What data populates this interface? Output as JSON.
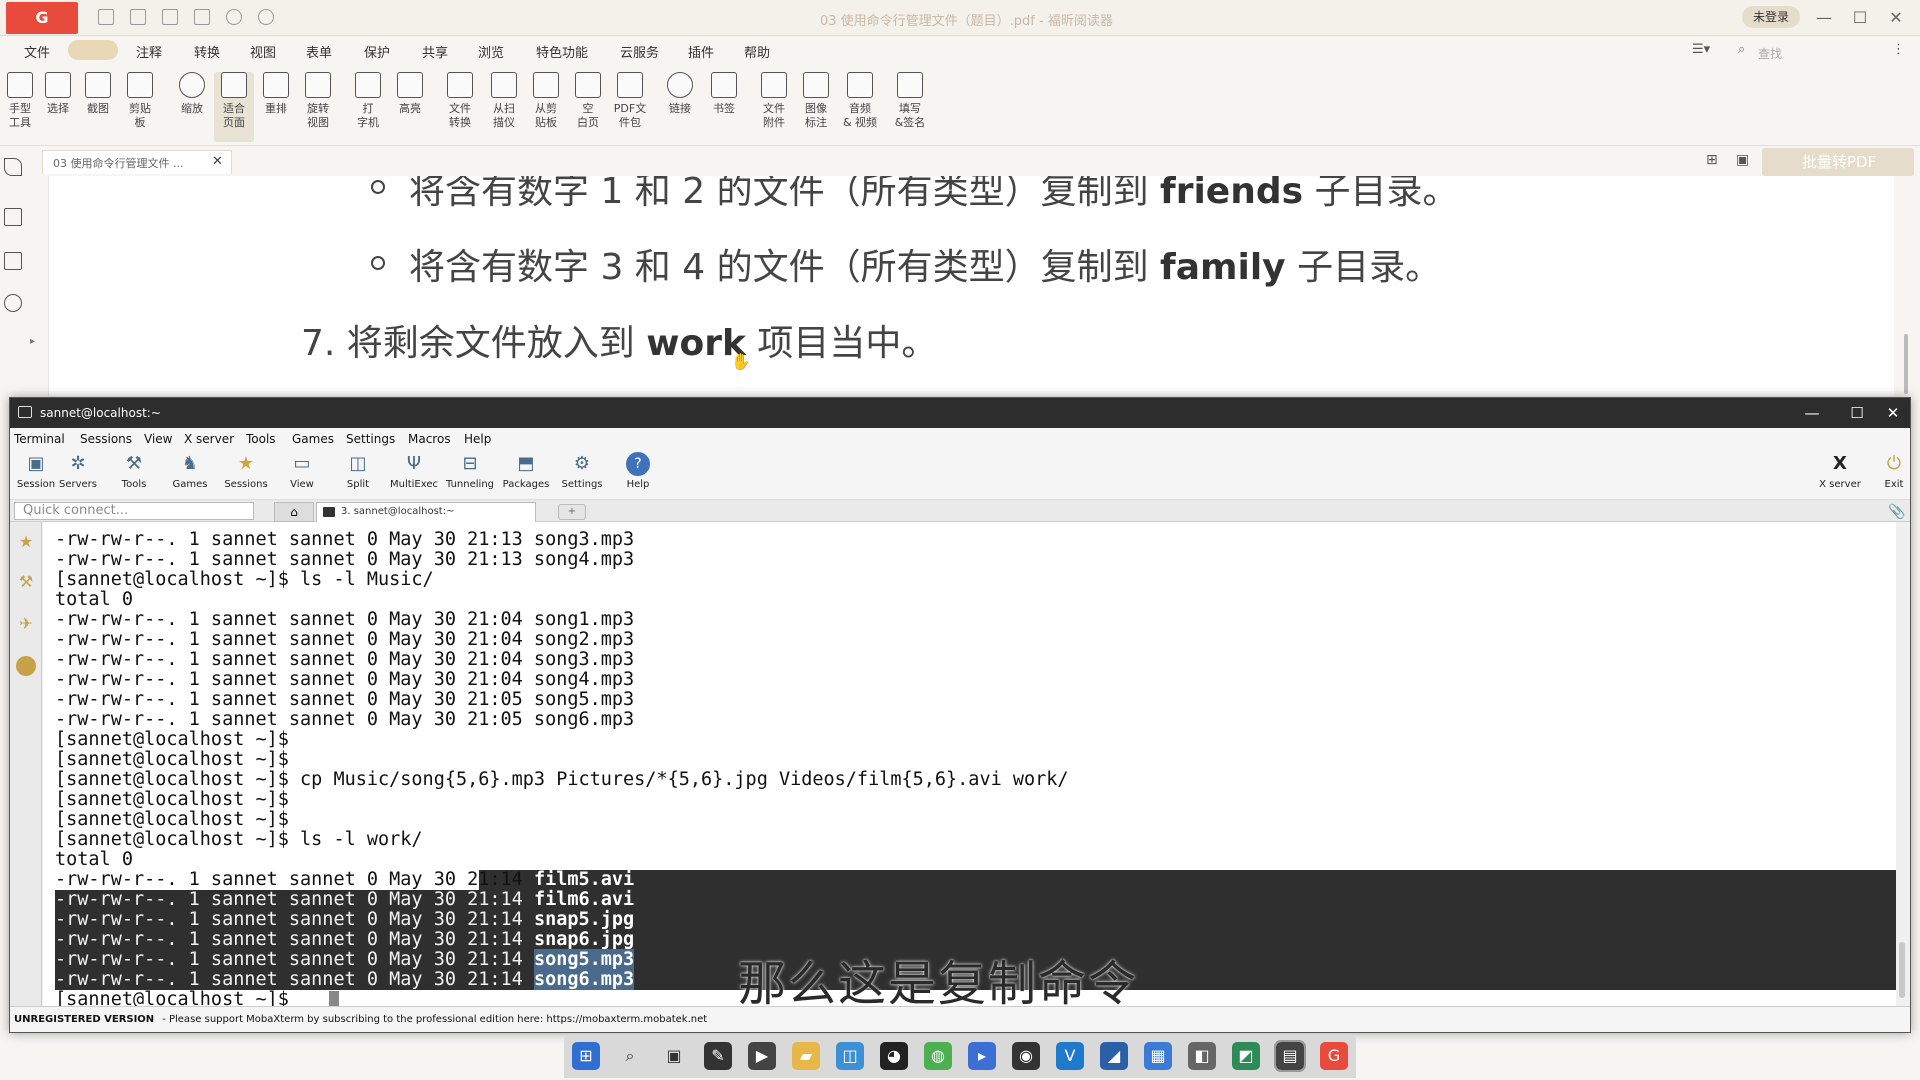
{
  "pdf_reader": {
    "title": "03 使用命令行管理文件（题目）.pdf - 福昕阅读器",
    "login_label": "未登录",
    "menu": [
      "文件",
      "注释",
      "转换",
      "视图",
      "表单",
      "保护",
      "共享",
      "浏览",
      "特色功能",
      "云服务",
      "插件",
      "帮助"
    ],
    "search_placeholder": "查找",
    "ribbon": [
      {
        "label": "手型\n工具",
        "icon": "hand-icon"
      },
      {
        "label": "选择",
        "icon": "text-select-icon"
      },
      {
        "label": "截图",
        "icon": "screenshot-icon"
      },
      {
        "label": "剪贴\n板",
        "icon": "clipboard-icon"
      },
      {
        "label": "缩放",
        "icon": "zoom-icon"
      },
      {
        "label": "适合\n页面",
        "icon": "fit-page-icon"
      },
      {
        "label": "重排",
        "icon": "reflow-icon"
      },
      {
        "label": "旋转\n视图",
        "icon": "rotate-icon"
      },
      {
        "label": "打\n字机",
        "icon": "typewriter-icon"
      },
      {
        "label": "高亮",
        "icon": "highlight-icon"
      },
      {
        "label": "文件\n转换",
        "icon": "file-convert-icon"
      },
      {
        "label": "从扫\n描仪",
        "icon": "scanner-icon"
      },
      {
        "label": "从剪\n贴板",
        "icon": "from-clipboard-icon"
      },
      {
        "label": "空\n白页",
        "icon": "blank-page-icon"
      },
      {
        "label": "PDF文\n件包",
        "icon": "pdf-package-icon"
      },
      {
        "label": "链接",
        "icon": "link-icon"
      },
      {
        "label": "书签",
        "icon": "bookmark-icon"
      },
      {
        "label": "文件\n附件",
        "icon": "attachment-icon"
      },
      {
        "label": "图像\n标注",
        "icon": "image-annotation-icon"
      },
      {
        "label": "音频\n& 视频",
        "icon": "audio-video-icon"
      },
      {
        "label": "填写\n&签名",
        "icon": "fill-sign-icon"
      }
    ],
    "doc_tab": "03 使用命令行管理文件 ...",
    "batch_button": "批量转PDF",
    "page_lines": {
      "line1_pre": "将含有数字 1 和 2 的文件（所有类型）复制到 ",
      "line1_bold": "friends",
      "line1_post": " 子目录。",
      "line2_pre": "将含有数字 3 和 4 的文件（所有类型）复制到 ",
      "line2_bold": "family",
      "line2_post": " 子目录。",
      "line3_pre": "7. 将剩余文件放入到 ",
      "line3_bold": "work",
      "line3_post": " 项目当中。"
    }
  },
  "mobaxterm": {
    "title": "sannet@localhost:~",
    "menu": [
      "Terminal",
      "Sessions",
      "View",
      "X server",
      "Tools",
      "Games",
      "Settings",
      "Macros",
      "Help"
    ],
    "toolbar": [
      {
        "label": "Session",
        "icon": "session-icon"
      },
      {
        "label": "Servers",
        "icon": "servers-icon"
      },
      {
        "label": "Tools",
        "icon": "tools-icon"
      },
      {
        "label": "Games",
        "icon": "games-icon"
      },
      {
        "label": "Sessions",
        "icon": "star-icon"
      },
      {
        "label": "View",
        "icon": "view-icon"
      },
      {
        "label": "Split",
        "icon": "split-icon"
      },
      {
        "label": "MultiExec",
        "icon": "multiexec-icon"
      },
      {
        "label": "Tunneling",
        "icon": "tunneling-icon"
      },
      {
        "label": "Packages",
        "icon": "packages-icon"
      },
      {
        "label": "Settings",
        "icon": "settings-icon"
      },
      {
        "label": "Help",
        "icon": "help-icon"
      }
    ],
    "toolbar_right": [
      {
        "label": "X server",
        "icon": "x-server-icon"
      },
      {
        "label": "Exit",
        "icon": "exit-icon"
      }
    ],
    "quick_connect_placeholder": "Quick connect...",
    "session_tab": "3. sannet@localhost:~",
    "terminal_lines": [
      "-rw-rw-r--. 1 sannet sannet 0 May 30 21:13 song3.mp3",
      "-rw-rw-r--. 1 sannet sannet 0 May 30 21:13 song4.mp3",
      "[sannet@localhost ~]$ ls -l Music/",
      "total 0",
      "-rw-rw-r--. 1 sannet sannet 0 May 30 21:04 song1.mp3",
      "-rw-rw-r--. 1 sannet sannet 0 May 30 21:04 song2.mp3",
      "-rw-rw-r--. 1 sannet sannet 0 May 30 21:04 song3.mp3",
      "-rw-rw-r--. 1 sannet sannet 0 May 30 21:04 song4.mp3",
      "-rw-rw-r--. 1 sannet sannet 0 May 30 21:05 song5.mp3",
      "-rw-rw-r--. 1 sannet sannet 0 May 30 21:05 song6.mp3",
      "[sannet@localhost ~]$",
      "[sannet@localhost ~]$",
      "[sannet@localhost ~]$ cp Music/song{5,6}.mp3 Pictures/*{5,6}.jpg Videos/film{5,6}.avi work/",
      "[sannet@localhost ~]$",
      "[sannet@localhost ~]$",
      "[sannet@localhost ~]$ ls -l work/",
      "total 0"
    ],
    "work_listing": [
      {
        "meta": "-rw-rw-r--. 1 sannet sannet 0 May 30 21:14 ",
        "name": "film5.avi",
        "row_highlight": false,
        "name_selected": false
      },
      {
        "meta": "-rw-rw-r--. 1 sannet sannet 0 May 30 21:14 ",
        "name": "film6.avi",
        "row_highlight": true,
        "name_selected": false
      },
      {
        "meta": "-rw-rw-r--. 1 sannet sannet 0 May 30 21:14 ",
        "name": "snap5.jpg",
        "row_highlight": true,
        "name_selected": false
      },
      {
        "meta": "-rw-rw-r--. 1 sannet sannet 0 May 30 21:14 ",
        "name": "snap6.jpg",
        "row_highlight": true,
        "name_selected": false
      },
      {
        "meta": "-rw-rw-r--. 1 sannet sannet 0 May 30 21:14 ",
        "name": "song5.mp3",
        "row_highlight": true,
        "name_selected": true
      },
      {
        "meta": "-rw-rw-r--. 1 sannet sannet 0 May 30 21:14 ",
        "name": "song6.mp3",
        "row_highlight": true,
        "name_selected": true
      }
    ],
    "prompt": "[sannet@localhost ~]$ ",
    "subtitle": "那么这是复制命令",
    "status_bold": "UNREGISTERED VERSION",
    "status_text": "-  Please support MobaXterm by subscribing to the professional edition here:  https://mobaxterm.mobatek.net"
  },
  "taskbar_icons": [
    "windows-start-icon",
    "search-icon",
    "task-view-icon",
    "app-icon-1",
    "app-icon-2",
    "folder-icon",
    "app-icon-3",
    "qq-icon",
    "wechat-icon",
    "app-icon-4",
    "app-icon-5",
    "vscode-icon",
    "app-icon-6",
    "app-icon-7",
    "app-icon-8",
    "app-icon-9",
    "mobaxterm-icon",
    "foxit-icon"
  ]
}
